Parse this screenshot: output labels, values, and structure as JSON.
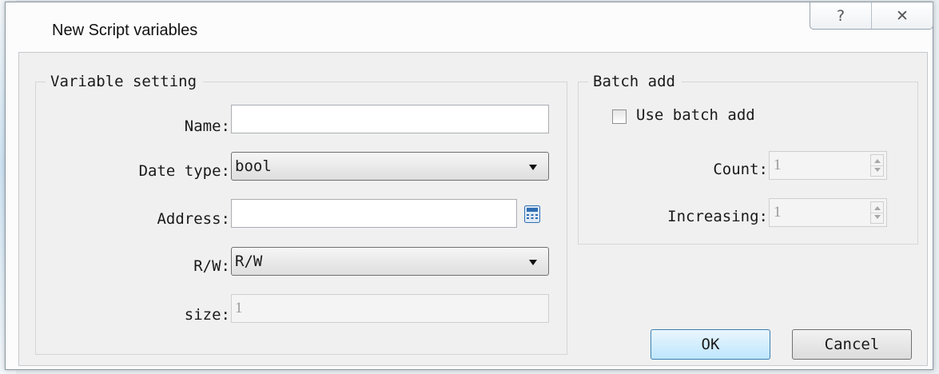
{
  "window": {
    "title": "New Script  variables",
    "help_glyph": "?",
    "close_glyph": "✕"
  },
  "variable_setting": {
    "title": "Variable setting",
    "name_label": "Name:",
    "name_value": "",
    "date_type_label": "Date type:",
    "date_type_value": "bool",
    "address_label": "Address:",
    "address_value": "",
    "rw_label": "R/W:",
    "rw_value": "R/W",
    "size_label": "size:",
    "size_value": "1"
  },
  "batch_add": {
    "title": "Batch add",
    "use_batch_label": "Use batch add",
    "use_batch_checked": false,
    "count_label": "Count:",
    "count_value": "1",
    "increasing_label": "Increasing:",
    "increasing_value": "1"
  },
  "buttons": {
    "ok": "OK",
    "cancel": "Cancel"
  },
  "icons": {
    "calculator": "calculator-icon",
    "help": "help-icon",
    "close": "close-icon"
  },
  "colors": {
    "default_button": "#bee6fd",
    "calculator_accent": "#2f6fb3"
  }
}
